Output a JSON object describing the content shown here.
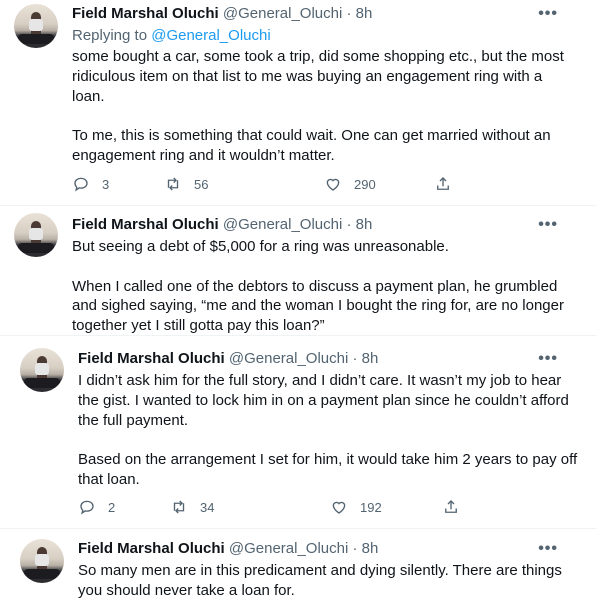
{
  "tweets": [
    {
      "name": "Field Marshal Oluchi",
      "handle": "@General_Oluchi",
      "sep": "·",
      "time": "8h",
      "more": "•••",
      "reply_prefix": "Replying to",
      "reply_handle": "@General_Oluchi",
      "text": "some bought a car, some took a trip, did some shopping etc., but the most\nridiculous item on that list to me was buying an engagement ring with a\nloan.\n\nTo me, this is something that could wait. One can get married without an\nengagement ring and it wouldn’t matter.",
      "replies": "3",
      "retweets": "56",
      "likes": "290"
    },
    {
      "name": "Field Marshal Oluchi",
      "handle": "@General_Oluchi",
      "sep": "·",
      "time": "8h",
      "more": "•••",
      "text": "But seeing a debt of $5,000 for a ring was unreasonable.\n\nWhen I called one of the debtors to discuss a payment plan, he grumbled\nand sighed saying, “me and the woman I bought the ring for, are no longer\ntogether yet I still gotta pay this loan?”"
    },
    {
      "name": "Field Marshal Oluchi",
      "handle": "@General_Oluchi",
      "sep": "·",
      "time": "8h",
      "more": "•••",
      "text": "I didn’t ask him for the full story, and I didn’t care. It wasn’t my job to hear\nthe gist. I wanted to lock him in on a payment plan since he couldn’t afford\nthe full payment.\n\nBased on the arrangement I set for him, it would take him 2 years to pay off\nthat loan.",
      "replies": "2",
      "retweets": "34",
      "likes": "192"
    },
    {
      "name": "Field Marshal Oluchi",
      "handle": "@General_Oluchi",
      "sep": "·",
      "time": "8h",
      "more": "•••",
      "text": "So many men are in this predicament and dying silently. There are things\nyou should never take a loan for."
    }
  ],
  "icons": {
    "reply": "reply-icon",
    "retweet": "retweet-icon",
    "like": "heart-icon",
    "share": "share-icon"
  },
  "colors": {
    "text": "#0f1419",
    "muted": "#536471",
    "link": "#1d9bf0"
  }
}
